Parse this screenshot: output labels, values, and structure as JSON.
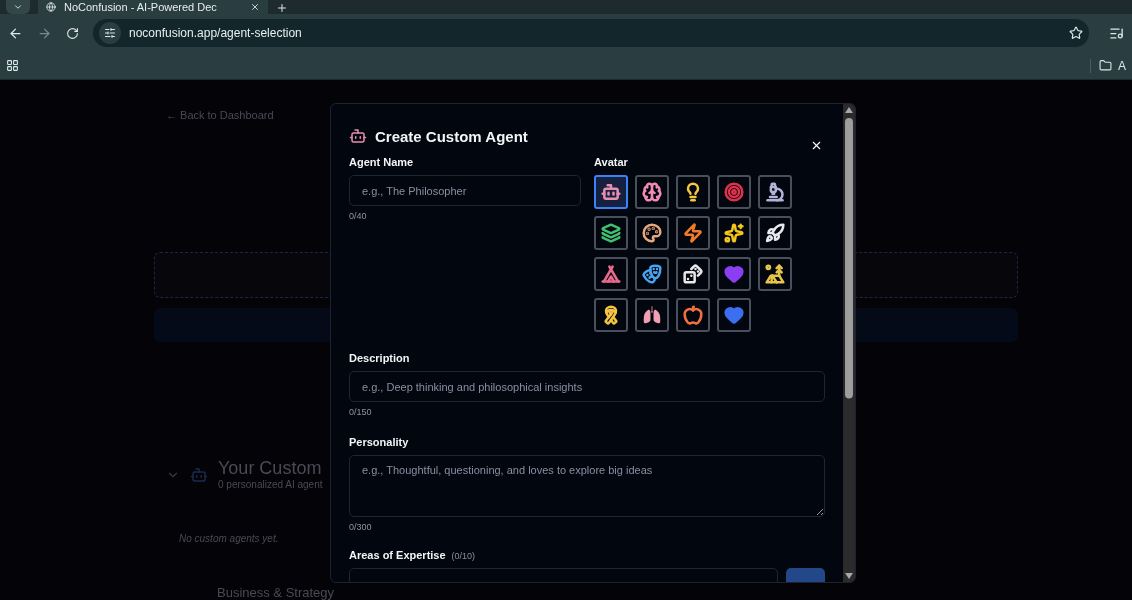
{
  "browser": {
    "tab_title": "NoConfusion - AI-Powered Dec",
    "url": "noconfusion.app/agent-selection",
    "bookmark_folder": "A"
  },
  "page": {
    "back_link": "← Back to Dashboard",
    "custom_section": {
      "title": "Your Custom",
      "subtitle": "0 personalized AI agent",
      "empty": "No custom agents yet.",
      "expanded": true
    },
    "next_section": "Business & Strategy"
  },
  "dialog": {
    "title": "Create Custom Agent",
    "name": {
      "label": "Agent Name",
      "placeholder": "e.g., The Philosopher",
      "counter": "0/40"
    },
    "avatar": {
      "label": "Avatar",
      "options": [
        {
          "kind": "robot",
          "color": "#e88fb0",
          "selected": true
        },
        {
          "kind": "brain",
          "color": "#f08bb4",
          "selected": false
        },
        {
          "kind": "bulb",
          "color": "#f5c542",
          "selected": false
        },
        {
          "kind": "target",
          "color": "#e0314b",
          "selected": false
        },
        {
          "kind": "microscope",
          "color": "#b0b4d8",
          "selected": false
        },
        {
          "kind": "books",
          "color": "#3fbf6f",
          "selected": false
        },
        {
          "kind": "palette",
          "color": "#e8a77a",
          "selected": false
        },
        {
          "kind": "bolt",
          "color": "#f07a2a",
          "selected": false
        },
        {
          "kind": "sparkle",
          "color": "#f5c518",
          "selected": false
        },
        {
          "kind": "rocket",
          "color": "#e8e8f0",
          "selected": false
        },
        {
          "kind": "tent",
          "color": "#e86a8a",
          "selected": false
        },
        {
          "kind": "masks",
          "color": "#4aa3f0",
          "selected": false
        },
        {
          "kind": "dice",
          "color": "#e8e8e8",
          "selected": false
        },
        {
          "kind": "heart",
          "color": "#8b3ff0",
          "selected": false
        },
        {
          "kind": "camping",
          "color": "#e8c54a",
          "selected": false
        },
        {
          "kind": "ribbon",
          "color": "#f5c542",
          "selected": false
        },
        {
          "kind": "lungs",
          "color": "#f0a0b0",
          "selected": false
        },
        {
          "kind": "peach",
          "color": "#f07040",
          "selected": false
        },
        {
          "kind": "heart",
          "color": "#3b6ff0",
          "selected": false
        }
      ]
    },
    "description": {
      "label": "Description",
      "placeholder": "e.g., Deep thinking and philosophical insights",
      "counter": "0/150"
    },
    "personality": {
      "label": "Personality",
      "placeholder": "e.g., Thoughtful, questioning, and loves to explore big ideas",
      "counter": "0/300"
    },
    "expertise": {
      "label": "Areas of Expertise",
      "count": "(0/10)"
    }
  }
}
